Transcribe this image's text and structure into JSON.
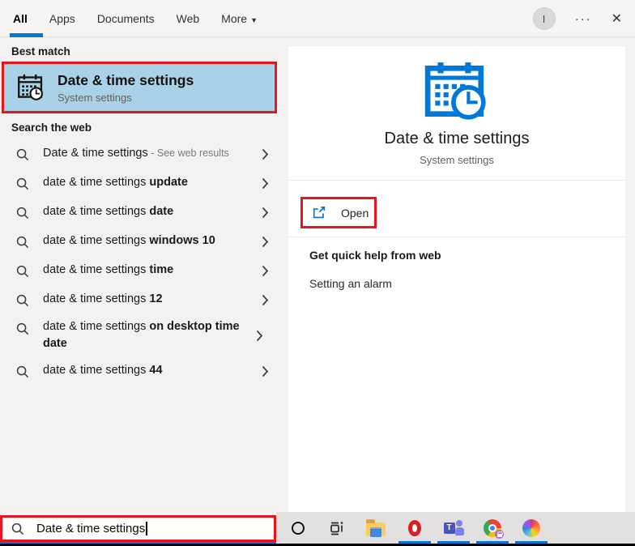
{
  "header": {
    "tabs": [
      {
        "label": "All"
      },
      {
        "label": "Apps"
      },
      {
        "label": "Documents"
      },
      {
        "label": "Web"
      },
      {
        "label": "More"
      }
    ],
    "more_arrow": "▼",
    "avatar_letter": "I",
    "ellipsis": "···",
    "close_glyph": "✕"
  },
  "left": {
    "best_match_header": "Best match",
    "best_match": {
      "title": "Date & time settings",
      "subtitle": "System settings"
    },
    "search_web_header": "Search the web",
    "suggestions": [
      {
        "text": "Date & time settings",
        "suffix": " - See web results"
      },
      {
        "text": "date & time settings ",
        "bold": "update"
      },
      {
        "text": "date & time settings ",
        "bold": "date"
      },
      {
        "text": "date & time settings ",
        "bold": "windows 10"
      },
      {
        "text": "date & time settings ",
        "bold": "time"
      },
      {
        "text": "date & time settings ",
        "bold": "12"
      },
      {
        "text": "date & time settings ",
        "bold": "on desktop time date"
      },
      {
        "text": "date & time settings ",
        "bold": "44"
      }
    ]
  },
  "right": {
    "title": "Date & time settings",
    "subtitle": "System settings",
    "open_label": "Open",
    "help_header": "Get quick help from web",
    "help_link": "Setting an alarm"
  },
  "search_bar": {
    "value": "Date & time settings"
  },
  "colors": {
    "accent": "#0078d7",
    "best_match_highlight": "#a9d1e8",
    "annotation_red": "#e8151d",
    "icon_blue": "#0078d7"
  }
}
